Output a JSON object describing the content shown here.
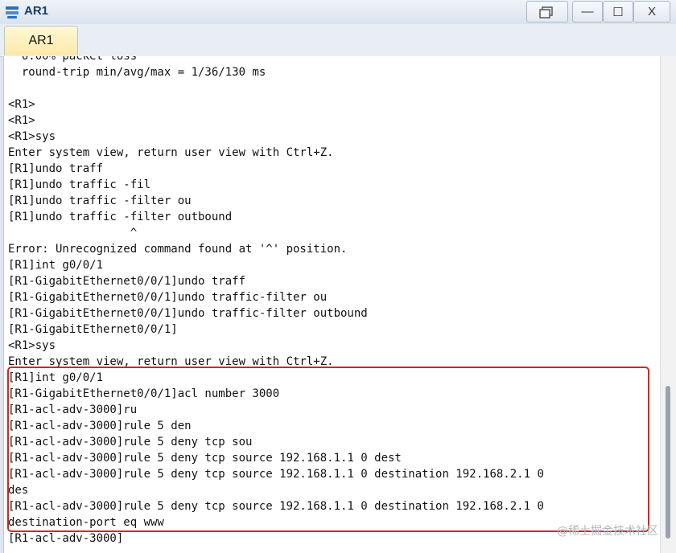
{
  "window": {
    "title": "AR1",
    "icon": "router-icon",
    "restore_icon": "restore-window-icon",
    "minimize_label": "—",
    "maximize_label": "☐",
    "close_label": "X"
  },
  "tabs": [
    {
      "label": "AR1",
      "active": true
    }
  ],
  "terminal": {
    "lines": [
      "  0.00% packet loss",
      "  round-trip min/avg/max = 1/36/130 ms",
      "",
      "<R1>",
      "<R1>",
      "<R1>sys",
      "Enter system view, return user view with Ctrl+Z.",
      "[R1]undo traff",
      "[R1]undo traffic -fil",
      "[R1]undo traffic -filter ou",
      "[R1]undo traffic -filter outbound",
      "                  ^",
      "Error: Unrecognized command found at '^' position.",
      "[R1]int g0/0/1",
      "[R1-GigabitEthernet0/0/1]undo traff",
      "[R1-GigabitEthernet0/0/1]undo traffic-filter ou",
      "[R1-GigabitEthernet0/0/1]undo traffic-filter outbound",
      "[R1-GigabitEthernet0/0/1]",
      "<R1>sys",
      "Enter system view, return user view with Ctrl+Z.",
      "[R1]int g0/0/1",
      "[R1-GigabitEthernet0/0/1]acl number 3000",
      "[R1-acl-adv-3000]ru",
      "[R1-acl-adv-3000]rule 5 den",
      "[R1-acl-adv-3000]rule 5 deny tcp sou",
      "[R1-acl-adv-3000]rule 5 deny tcp source 192.168.1.1 0 dest",
      "[R1-acl-adv-3000]rule 5 deny tcp source 192.168.1.1 0 destination 192.168.2.1 0",
      "des",
      "[R1-acl-adv-3000]rule 5 deny tcp source 192.168.1.1 0 destination 192.168.2.1 0",
      "destination-port eq www",
      "[R1-acl-adv-3000]"
    ],
    "highlight_color": "#e02020"
  },
  "watermark": "@稀土掘金技术社区"
}
